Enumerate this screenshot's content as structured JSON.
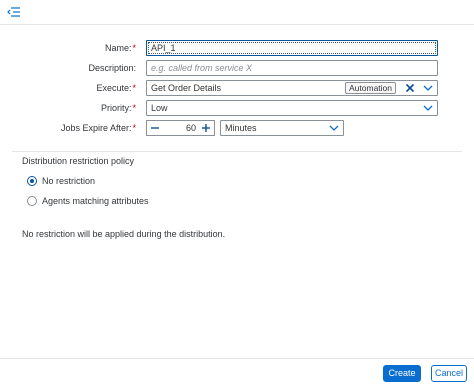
{
  "icons": {
    "nav": "menu-collapse-icon",
    "clear": "close-icon",
    "dropdown": "chevron-down-icon",
    "decrement": "minus-icon",
    "increment": "plus-icon"
  },
  "colors": {
    "accent": "#0a6ed1",
    "required": "#bb0000",
    "border": "#89919a"
  },
  "form": {
    "name": {
      "label": "Name:",
      "required_mark": "*",
      "value": "API_1"
    },
    "description": {
      "label": "Description:",
      "placeholder": "e.g. called from service X"
    },
    "execute": {
      "label": "Execute:",
      "required_mark": "*",
      "value": "Get Order Details",
      "tag": "Automation"
    },
    "priority": {
      "label": "Priority:",
      "required_mark": "*",
      "value": "Low"
    },
    "jobs_expire": {
      "label": "Jobs Expire After:",
      "required_mark": "*",
      "value": "60",
      "unit": "Minutes"
    }
  },
  "distribution": {
    "title": "Distribution restriction policy",
    "options": [
      {
        "label": "No restriction",
        "selected": true
      },
      {
        "label": "Agents matching attributes",
        "selected": false
      }
    ],
    "info": "No restriction will be applied during the distribution."
  },
  "footer": {
    "create_label": "Create",
    "cancel_label": "Cancel"
  }
}
